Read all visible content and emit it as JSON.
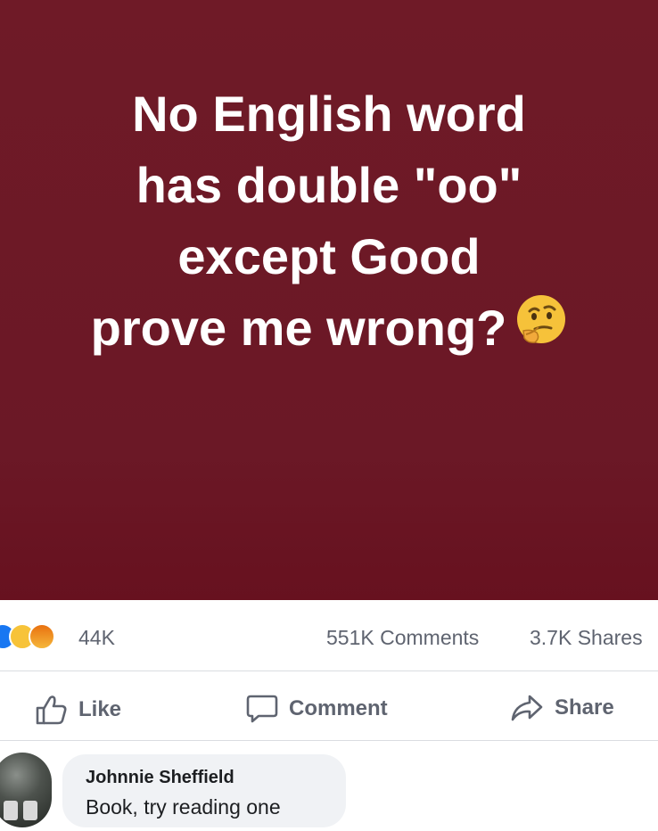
{
  "post": {
    "text_lines": [
      "No English word",
      "has double \"oo\"",
      "except Good",
      "prove me wrong?"
    ],
    "background_color": "#6d1826",
    "emoji": "thinking-face"
  },
  "stats": {
    "reaction_icons": [
      "like",
      "haha",
      "angry"
    ],
    "reactions_count": "44K",
    "comments_count": "551K Comments",
    "shares_count": "3.7K Shares"
  },
  "actions": {
    "like_label": "Like",
    "comment_label": "Comment",
    "share_label": "Share"
  },
  "comment": {
    "author": "Johnnie Sheffield",
    "text": "Book, try reading one"
  }
}
